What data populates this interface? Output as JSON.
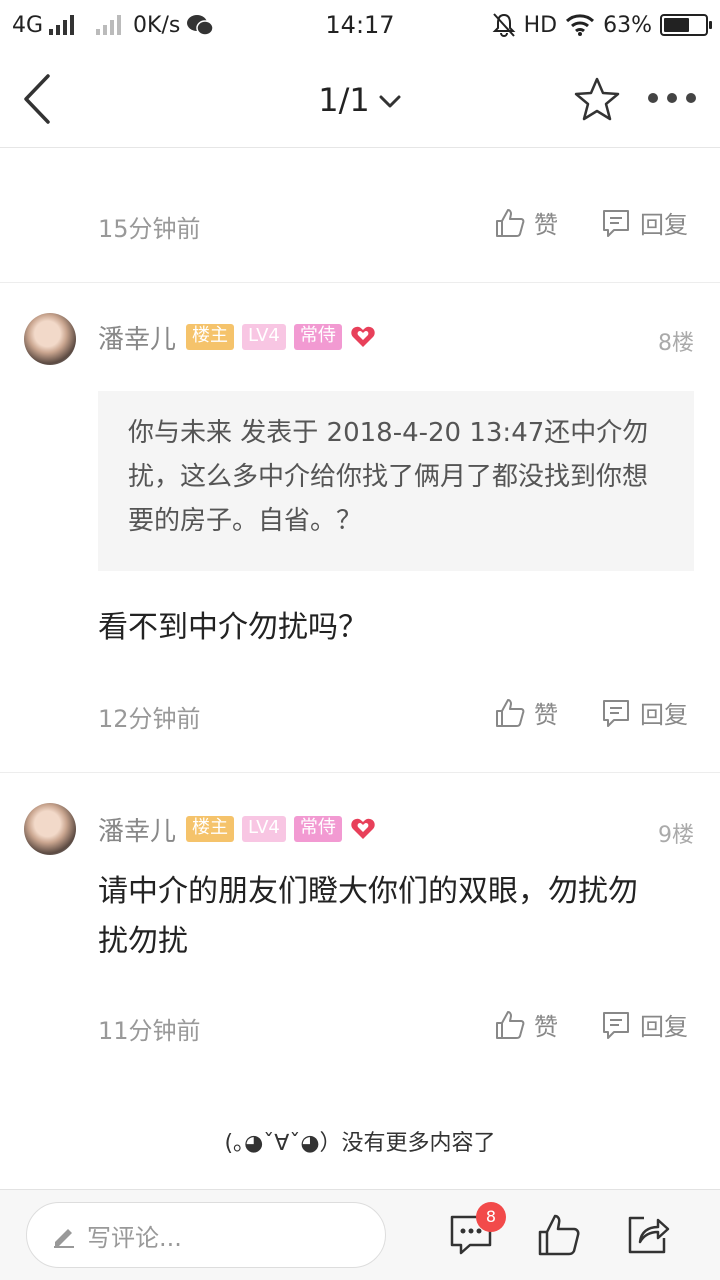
{
  "status_bar": {
    "network": "4G",
    "speed": "0K/s",
    "time": "14:17",
    "hd": "HD",
    "battery": "63%",
    "battery_level": 0.63
  },
  "nav": {
    "title": "1/1"
  },
  "previous_post": {
    "time": "15分钟前",
    "like": "赞",
    "reply": "回复"
  },
  "posts": [
    {
      "username": "潘幸儿",
      "badges": [
        "楼主",
        "LV4",
        "常侍"
      ],
      "floor": "8楼",
      "quote": "你与未来 发表于 2018-4-20 13:47还中介勿扰，这么多中介给你找了俩月了都没找到你想要的房子。自省。？",
      "text": "看不到中介勿扰吗？",
      "time": "12分钟前",
      "like": "赞",
      "reply": "回复"
    },
    {
      "username": "潘幸儿",
      "badges": [
        "楼主",
        "LV4",
        "常侍"
      ],
      "floor": "9楼",
      "text": "请中介的朋友们瞪大你们的双眼，勿扰勿扰勿扰",
      "time": "11分钟前",
      "like": "赞",
      "reply": "回复"
    }
  ],
  "end_message": "(｡◕ˇ∀ˇ◕）没有更多内容了",
  "bottom_bar": {
    "comment_placeholder": "写评论...",
    "comment_count": "8"
  },
  "colors": {
    "host_badge": "#f5c36b",
    "lv_badge": "#f8c6e3",
    "vip_badge": "#f29ad2",
    "heart": "#e8405a",
    "count_badge": "#f24a4a"
  }
}
